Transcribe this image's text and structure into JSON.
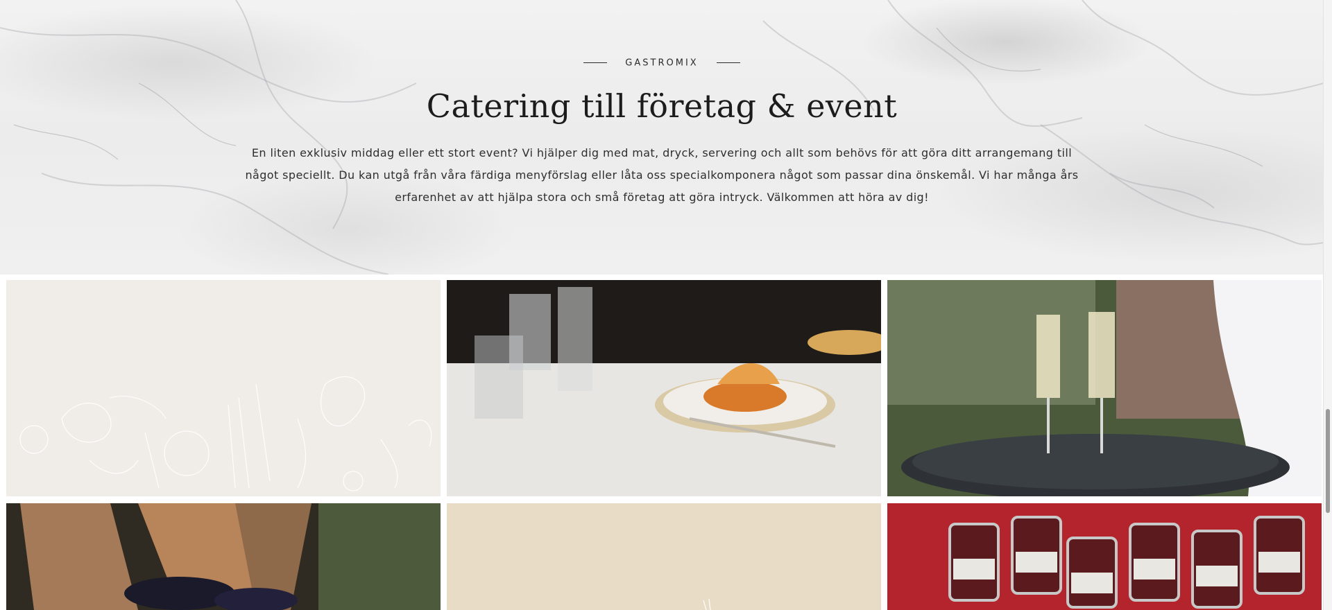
{
  "hero": {
    "eyebrow": "GASTROMIX",
    "title": "Catering till företag & event",
    "description": "En liten exklusiv middag eller ett stort event? Vi hjälper dig med mat, dryck, servering och allt som behövs för att göra ditt arrangemang till något speciellt. Du kan utgå från våra färdiga menyförslag eller låta oss specialkomponera något som passar dina önskemål. Vi har många års erfarenhet av att hjälpa stora och små företag att göra intryck. Välkommen att höra av dig!"
  },
  "gallery": {
    "tiles": [
      {
        "kind": "illustration",
        "icon": "food-line-art-illustration"
      },
      {
        "kind": "photo",
        "icon": "plated-dinner-photo"
      },
      {
        "kind": "photo",
        "icon": "champagne-tray-photo"
      },
      {
        "kind": "photo",
        "icon": "dessert-photo"
      },
      {
        "kind": "illustration",
        "icon": "beige-illustration"
      },
      {
        "kind": "photo",
        "icon": "jam-jars-photo"
      }
    ]
  },
  "colors": {
    "tile_light": "#f0ece7",
    "tile_beige": "#e9dcc6",
    "text": "#2e2e2e"
  }
}
